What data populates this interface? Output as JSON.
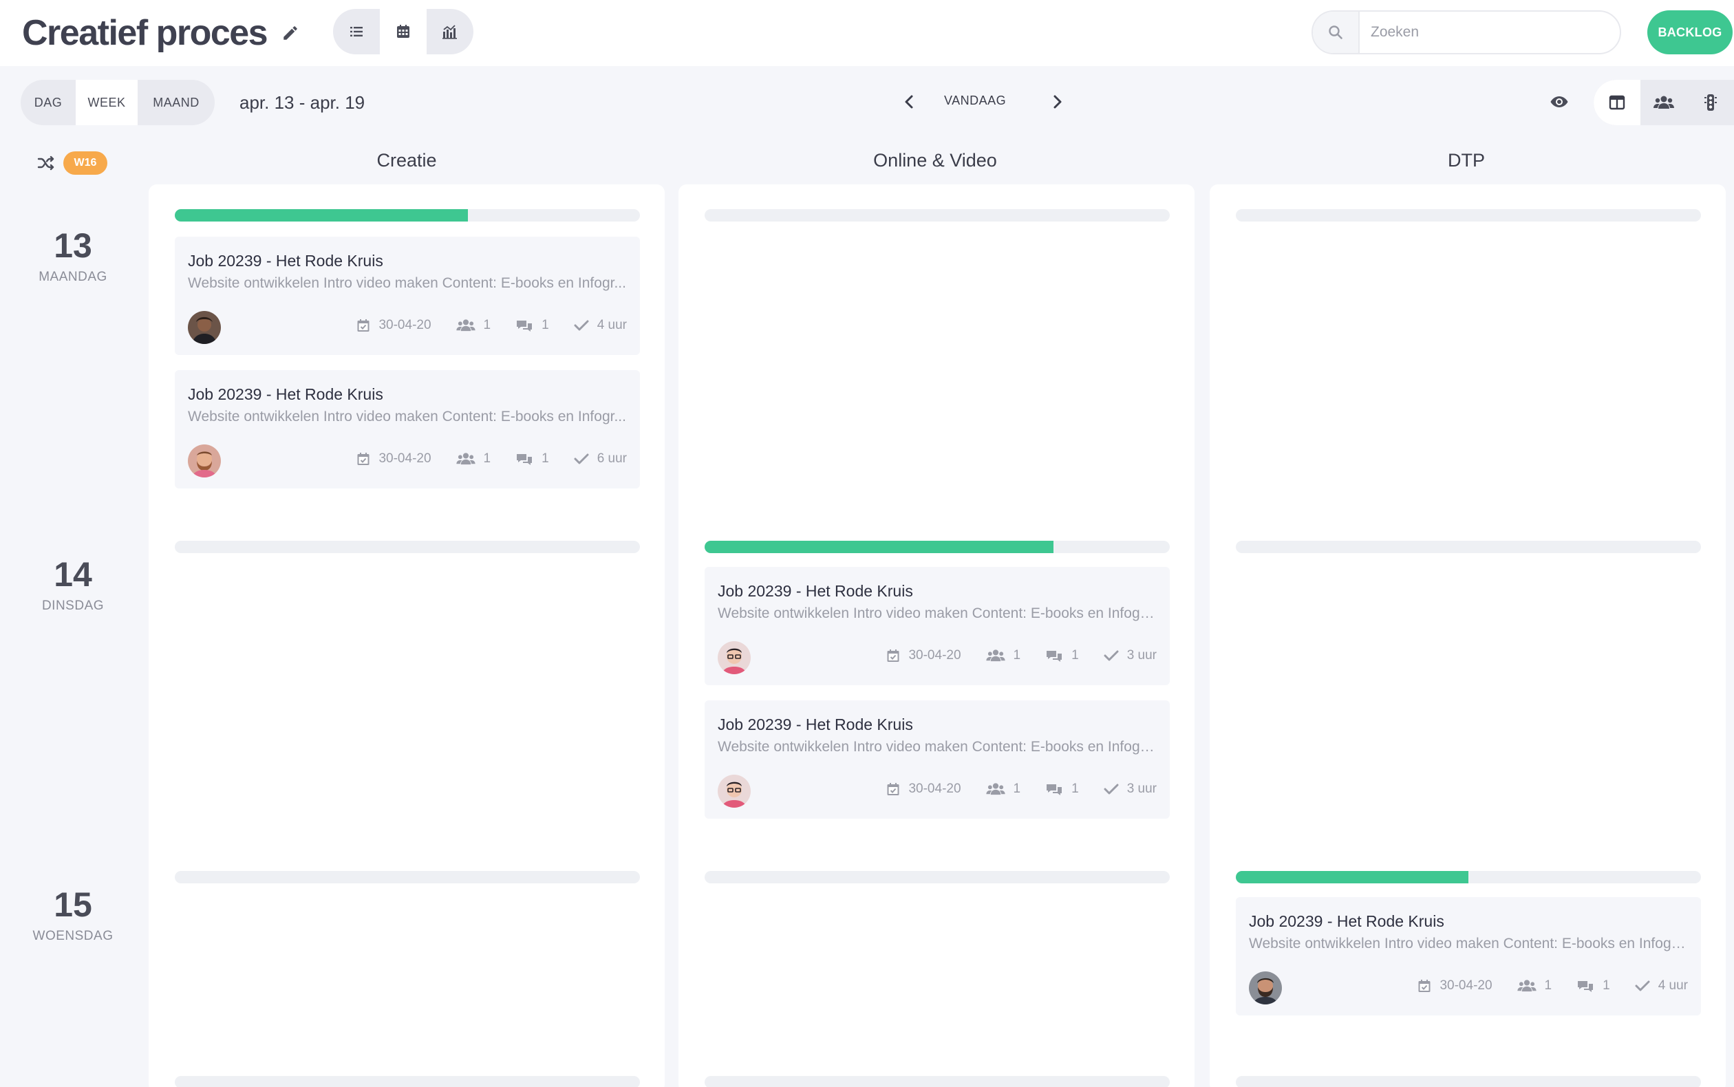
{
  "header": {
    "title": "Creatief proces",
    "search_placeholder": "Zoeken",
    "backlog_label": "BACKLOG"
  },
  "toolbar": {
    "periods": [
      "DAG",
      "WEEK",
      "MAAND"
    ],
    "active_period": "WEEK",
    "date_range": "apr. 13 - apr. 19",
    "today_label": "VANDAAG"
  },
  "week_badge": "W16",
  "columns": [
    "Creatie",
    "Online & Video",
    "DTP"
  ],
  "days": [
    {
      "num": "13",
      "name": "MAANDAG"
    },
    {
      "num": "14",
      "name": "DINSDAG"
    },
    {
      "num": "15",
      "name": "WOENSDAG"
    }
  ],
  "capacity": {
    "creatie_13": 0.63,
    "online_14": 0.75,
    "dtp_15": 0.5
  },
  "cards": [
    {
      "title": "Job 20239 - Het Rode Kruis",
      "desc": "Website ontwikkelen Intro video maken Content: E-books en Infogr...",
      "date": "30-04-20",
      "people": "1",
      "comments": "1",
      "hours": "4 uur"
    },
    {
      "title": "Job 20239 - Het Rode Kruis",
      "desc": "Website ontwikkelen Intro video maken Content: E-books en Infogr...",
      "date": "30-04-20",
      "people": "1",
      "comments": "1",
      "hours": "6 uur"
    },
    {
      "title": "Job 20239 - Het Rode Kruis",
      "desc": "Website ontwikkelen Intro video maken Content: E-books en Infogra...",
      "date": "30-04-20",
      "people": "1",
      "comments": "1",
      "hours": "3 uur"
    },
    {
      "title": "Job 20239 - Het Rode Kruis",
      "desc": "Website ontwikkelen Intro video maken Content: E-books en Infogra...",
      "date": "30-04-20",
      "people": "1",
      "comments": "1",
      "hours": "3 uur"
    },
    {
      "title": "Job 20239 - Het Rode Kruis",
      "desc": "Website ontwikkelen Intro video maken Content: E-books en Infogra...",
      "date": "30-04-20",
      "people": "1",
      "comments": "1",
      "hours": "4 uur"
    }
  ],
  "icons": {
    "edit": "pencil-icon",
    "list": "list-icon",
    "calendar": "calendar-icon",
    "chart": "chart-icon",
    "search": "search-icon",
    "prev": "chevron-left-icon",
    "next": "chevron-right-icon",
    "eye": "eye-icon",
    "columns": "columns-icon",
    "team": "team-icon",
    "traffic": "traffic-light-icon",
    "shuffle": "shuffle-icon"
  },
  "colors": {
    "accent": "#3ec791",
    "week_badge": "#f7a94b",
    "background": "#f5f6fa"
  }
}
